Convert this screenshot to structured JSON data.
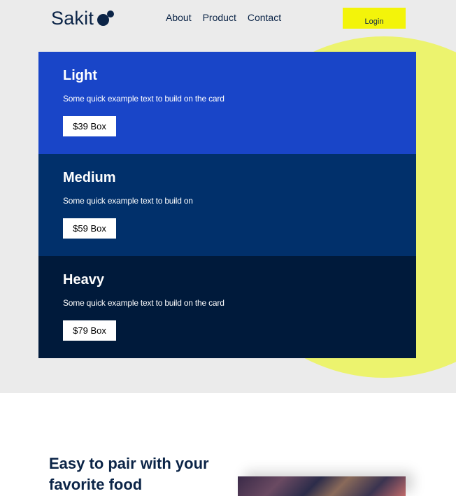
{
  "header": {
    "logo_text": "Sakit",
    "nav": [
      {
        "label": "About"
      },
      {
        "label": "Product"
      },
      {
        "label": "Contact"
      }
    ],
    "login_label": "Login"
  },
  "cards": [
    {
      "title": "Light",
      "text": "Some quick example text to build on the card",
      "button": "$39 Box",
      "color": "#1945c8"
    },
    {
      "title": "Medium",
      "text": "Some quick example text to build on",
      "button": "$59 Box",
      "color": "#01306b"
    },
    {
      "title": "Heavy",
      "text": "Some quick example text to build on the card",
      "button": "$79 Box",
      "color": "#001a3b"
    }
  ],
  "pairing": {
    "title": "Easy to pair with your favorite food"
  },
  "colors": {
    "accent_yellow": "#f3f40a",
    "circle_yellow": "#ecf36e",
    "navy": "#0b2447",
    "hero_bg": "#ebebeb"
  }
}
